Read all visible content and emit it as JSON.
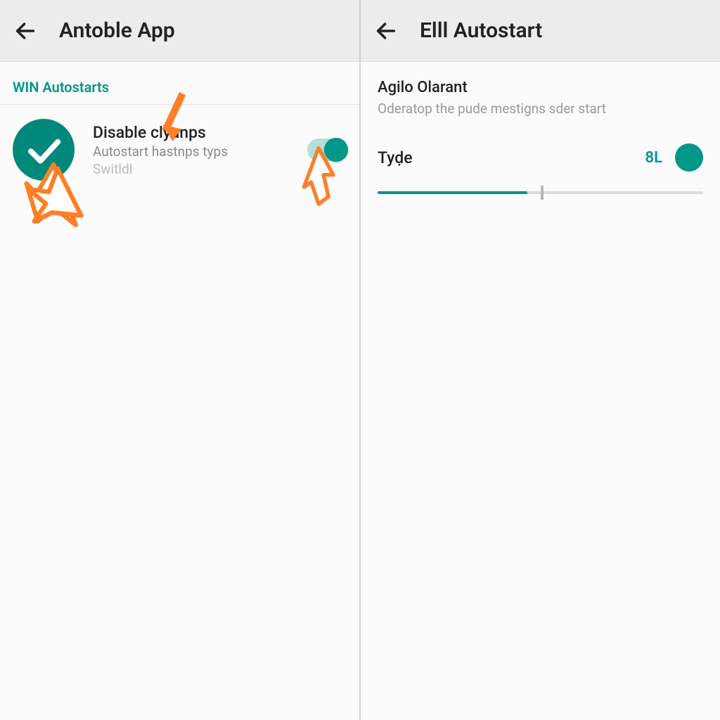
{
  "left": {
    "appbar_title": "Antoble App",
    "section_label": "WIN Autostarts",
    "item": {
      "title": "Disable clyanps",
      "sub1": "Autostart hastnps typs",
      "sub2": "Switldl"
    },
    "toggle_on": true
  },
  "right": {
    "appbar_title": "Elll Autostart",
    "desc_title": "Agilo Olarant",
    "desc_sub": "Oderatop the pude mestigns sder start",
    "slider_label": "Tyḍe",
    "slider_value": "8L",
    "slider_fill_pct": 46
  },
  "colors": {
    "accent": "#009688",
    "annotation": "#ff7f27"
  }
}
